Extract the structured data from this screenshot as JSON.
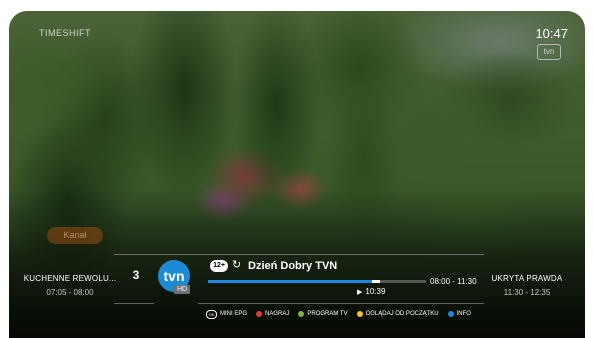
{
  "top_bar": {
    "mode_label": "TIMESHIFT",
    "clock": "10:47",
    "watermark": "tvn"
  },
  "background_chip": "Kanał",
  "previous_program": {
    "title": "KUCHENNE REWOLU...",
    "time": "07:05 - 08:00"
  },
  "next_program": {
    "title": "UKRYTA PRAWDA",
    "time": "11:30 - 12:35"
  },
  "channel": {
    "number": "3",
    "logo_text": "tvn",
    "hd_label": "HD",
    "logo_color": "#1a8bd4"
  },
  "current_program": {
    "age_rating": "12+",
    "restart_icon": "restart-icon",
    "title": "Dzień Dobry TVN",
    "time_range": "08:00 - 11:30",
    "playback_position": "10:39",
    "progress_played": 0.75,
    "progress_buffered": 0.79
  },
  "colors": {
    "accent": "#1e88e5",
    "red": "#e53935",
    "green": "#7cb342",
    "yellow": "#fbc02d",
    "blue": "#1e88e5"
  },
  "legend": {
    "ok_icon_text": "OK",
    "mini_epg": "MINI EPG",
    "record": "NAGRAJ",
    "tv_guide": "PROGRAM TV",
    "watch_from_start": "OGLĄDAJ OD POCZĄTKU",
    "info": "INFO"
  }
}
